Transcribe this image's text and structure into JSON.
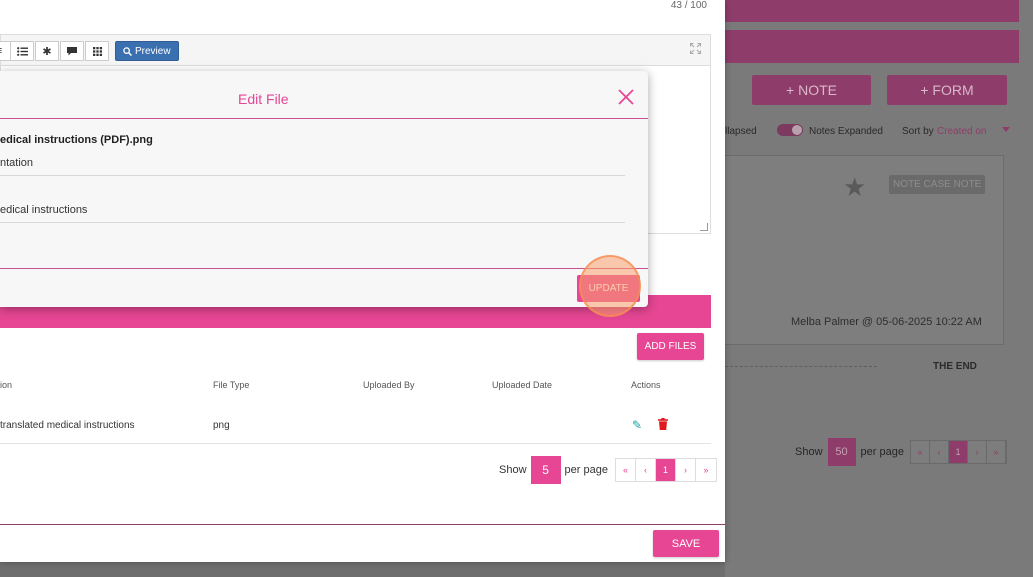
{
  "background": {
    "note_button": "+ NOTE",
    "form_button": "+ FORM",
    "collapsed_label": "llapsed",
    "expanded_label": "Notes Expanded",
    "sort_label": "Sort by",
    "sort_value": "Created on",
    "note_tag": "NOTE CASE NOTE",
    "note_author": "Melba Palmer @ 05-06-2025 10:22 AM",
    "the_end": "THE END",
    "pager": {
      "show": "Show",
      "per_page_value": "50",
      "per_page": "per page",
      "pages": [
        "«",
        "‹",
        "1",
        "›",
        "»"
      ]
    }
  },
  "dialog": {
    "counter": "43 / 100",
    "toolbar": {
      "preview_label": "Preview"
    },
    "add_files": "ADD FILES",
    "table": {
      "headers": {
        "description": "ion",
        "file_type": "File Type",
        "uploaded_by": "Uploaded By",
        "uploaded_date": "Uploaded Date",
        "actions": "Actions"
      },
      "rows": [
        {
          "description": "translated medical instructions",
          "file_type": "png",
          "uploaded_by": "",
          "uploaded_date": ""
        }
      ]
    },
    "pager": {
      "show": "Show",
      "per_page_value": "5",
      "per_page": "per page",
      "pages": [
        "«",
        "‹",
        "1",
        "›",
        "»"
      ]
    },
    "save": "SAVE"
  },
  "modal": {
    "title": "Edit File",
    "file_name": "edical instructions (PDF).png",
    "field1_value": "ntation",
    "field2_value": "edical instructions",
    "update": "UPDATE"
  },
  "colors": {
    "accent": "#e64693",
    "preview": "#3a6fb0",
    "edit_icon": "#1aa3a3",
    "delete_icon": "#e0191f"
  }
}
